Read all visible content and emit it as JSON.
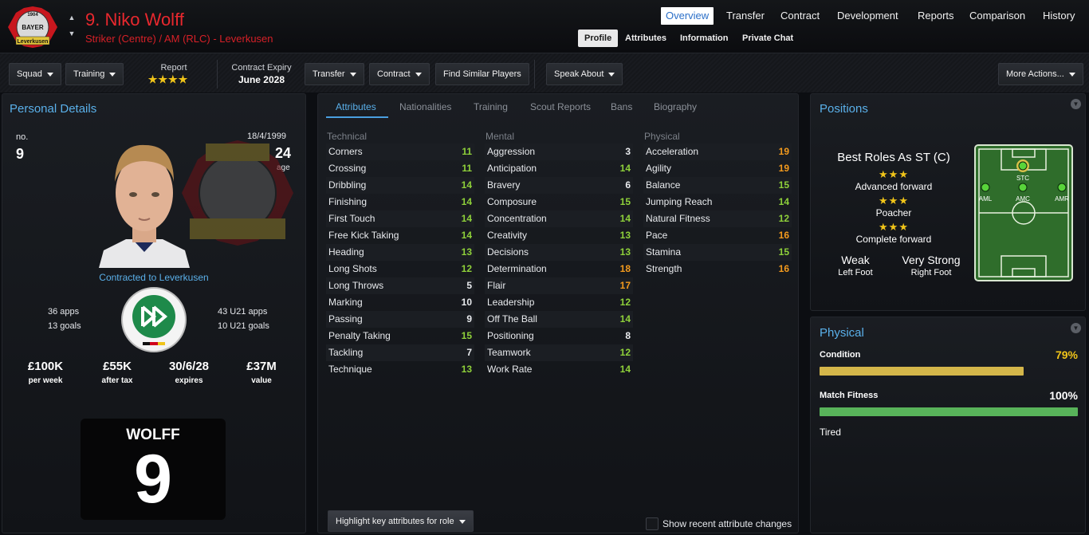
{
  "header": {
    "player_name": "9. Niko Wolff",
    "player_positions": "Striker (Centre) / AM (RLC) - Leverkusen",
    "crest_text": {
      "year": "1904",
      "name": "BAYER",
      "city": "Leverkusen"
    },
    "main_nav": [
      "Overview",
      "Transfer",
      "Contract",
      "Development",
      "Reports",
      "Comparison",
      "History"
    ],
    "sub_nav": [
      "Profile",
      "Attributes",
      "Information",
      "Private Chat"
    ]
  },
  "toolbar": {
    "squad": "Squad",
    "training": "Training",
    "report_label": "Report",
    "report_stars": "★★★★",
    "contract_label": "Contract Expiry",
    "contract_value": "June 2028",
    "transfer": "Transfer",
    "contract": "Contract",
    "find_similar": "Find Similar Players",
    "speak_about": "Speak About",
    "more_actions": "More Actions..."
  },
  "personal": {
    "title": "Personal Details",
    "no_label": "no.",
    "no_value": "9",
    "dob": "18/4/1999",
    "age_value": "24",
    "age_label": "age",
    "contracted": "Contracted to Leverkusen",
    "apps": "36 apps",
    "goals": "13 goals",
    "u21_apps": "43 U21 apps",
    "u21_goals": "10 U21 goals",
    "stats": [
      {
        "value": "£100K",
        "label": "per week"
      },
      {
        "value": "£55K",
        "label": "after tax"
      },
      {
        "value": "30/6/28",
        "label": "expires"
      },
      {
        "value": "£37M",
        "label": "value"
      }
    ],
    "shirt_name": "WOLFF",
    "shirt_number": "9"
  },
  "attributes": {
    "tabs": [
      "Attributes",
      "Nationalities",
      "Training",
      "Scout Reports",
      "Bans",
      "Biography"
    ],
    "technical_label": "Technical",
    "mental_label": "Mental",
    "physical_label": "Physical",
    "technical": [
      {
        "name": "Corners",
        "value": "11",
        "tier": "green"
      },
      {
        "name": "Crossing",
        "value": "11",
        "tier": "green"
      },
      {
        "name": "Dribbling",
        "value": "14",
        "tier": "green"
      },
      {
        "name": "Finishing",
        "value": "14",
        "tier": "green"
      },
      {
        "name": "First Touch",
        "value": "14",
        "tier": "green"
      },
      {
        "name": "Free Kick Taking",
        "value": "14",
        "tier": "green"
      },
      {
        "name": "Heading",
        "value": "13",
        "tier": "green"
      },
      {
        "name": "Long Shots",
        "value": "12",
        "tier": "green"
      },
      {
        "name": "Long Throws",
        "value": "5",
        "tier": "white"
      },
      {
        "name": "Marking",
        "value": "10",
        "tier": "white"
      },
      {
        "name": "Passing",
        "value": "9",
        "tier": "white"
      },
      {
        "name": "Penalty Taking",
        "value": "15",
        "tier": "green"
      },
      {
        "name": "Tackling",
        "value": "7",
        "tier": "white"
      },
      {
        "name": "Technique",
        "value": "13",
        "tier": "green"
      }
    ],
    "mental": [
      {
        "name": "Aggression",
        "value": "3",
        "tier": "white"
      },
      {
        "name": "Anticipation",
        "value": "14",
        "tier": "green"
      },
      {
        "name": "Bravery",
        "value": "6",
        "tier": "white"
      },
      {
        "name": "Composure",
        "value": "15",
        "tier": "green"
      },
      {
        "name": "Concentration",
        "value": "14",
        "tier": "green"
      },
      {
        "name": "Creativity",
        "value": "13",
        "tier": "green"
      },
      {
        "name": "Decisions",
        "value": "13",
        "tier": "green"
      },
      {
        "name": "Determination",
        "value": "18",
        "tier": "orange"
      },
      {
        "name": "Flair",
        "value": "17",
        "tier": "orange"
      },
      {
        "name": "Leadership",
        "value": "12",
        "tier": "green"
      },
      {
        "name": "Off The Ball",
        "value": "14",
        "tier": "green"
      },
      {
        "name": "Positioning",
        "value": "8",
        "tier": "white"
      },
      {
        "name": "Teamwork",
        "value": "12",
        "tier": "green"
      },
      {
        "name": "Work Rate",
        "value": "14",
        "tier": "green"
      }
    ],
    "physical": [
      {
        "name": "Acceleration",
        "value": "19",
        "tier": "orange"
      },
      {
        "name": "Agility",
        "value": "19",
        "tier": "orange"
      },
      {
        "name": "Balance",
        "value": "15",
        "tier": "green"
      },
      {
        "name": "Jumping Reach",
        "value": "14",
        "tier": "green"
      },
      {
        "name": "Natural Fitness",
        "value": "12",
        "tier": "green"
      },
      {
        "name": "Pace",
        "value": "16",
        "tier": "orange"
      },
      {
        "name": "Stamina",
        "value": "15",
        "tier": "green"
      },
      {
        "name": "Strength",
        "value": "16",
        "tier": "orange"
      }
    ],
    "highlight_button": "Highlight key attributes for role",
    "show_recent": "Show recent attribute changes"
  },
  "positions": {
    "title": "Positions",
    "best_roles": "Best Roles As ST (C)",
    "roles": [
      {
        "stars": "★★★",
        "name": "Advanced forward"
      },
      {
        "stars": "★★★",
        "name": "Poacher"
      },
      {
        "stars": "★★★",
        "name": "Complete forward"
      }
    ],
    "left_foot_rating": "Weak",
    "left_foot_label": "Left Foot",
    "right_foot_rating": "Very Strong",
    "right_foot_label": "Right Foot",
    "pitch_labels": {
      "stc": "STC",
      "aml": "AML",
      "amc": "AMC",
      "amr": "AMR"
    }
  },
  "physical": {
    "title": "Physical",
    "condition_label": "Condition",
    "condition_value": "79%",
    "condition_fraction": 0.79,
    "fitness_label": "Match Fitness",
    "fitness_value": "100%",
    "fitness_fraction": 1.0,
    "status": "Tired"
  },
  "colors": {
    "accent_blue": "#5ab0ea",
    "name_red": "#e8282e",
    "attr_green": "#8fd13a",
    "attr_orange": "#f39a1d",
    "condition_bar": "#d4b64a",
    "fitness_bar": "#58b35a"
  }
}
